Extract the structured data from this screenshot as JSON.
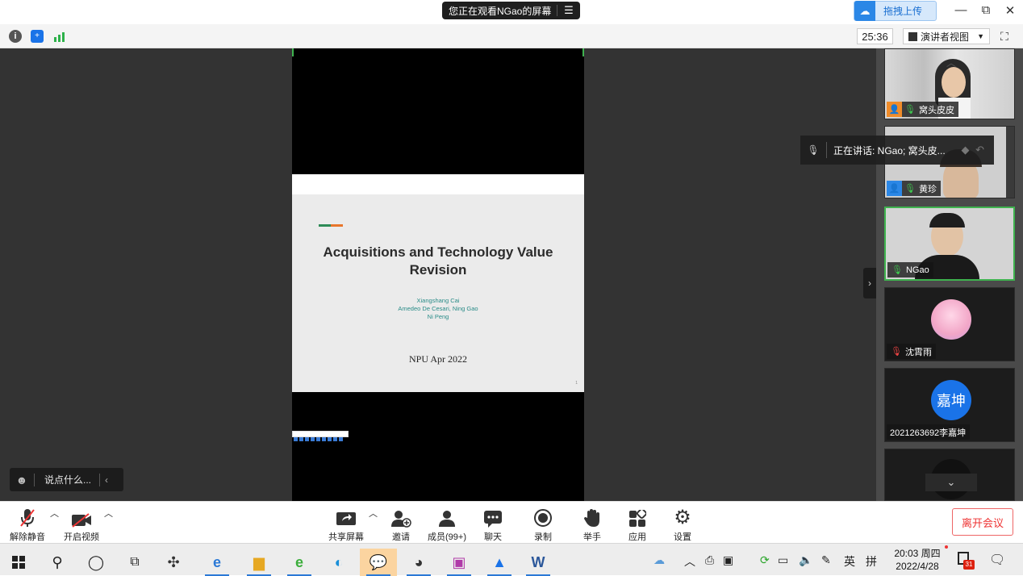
{
  "titlebar": {
    "share_status": "您正在观看NGao的屏幕",
    "menu_icon": "menu-lines-icon",
    "upload_button": "拖拽上传",
    "minimize": "—",
    "restore": "⧉",
    "close": "✕"
  },
  "toolbar": {
    "timer": "25:36",
    "view_mode": "演讲者视图"
  },
  "slide": {
    "title": "Acquisitions and Technology Value Revision",
    "authors_line1": "Xiangshang Cai",
    "authors_line2": "Amedeo De Cesari, Ning Gao",
    "authors_line3": "Ni Peng",
    "venue": "NPU Apr 2022",
    "page": "1"
  },
  "chat": {
    "placeholder": "说点什么..."
  },
  "speaking": {
    "text": "正在讲话: NGao; 窝头皮..."
  },
  "participants": [
    {
      "name": "窝头皮皮",
      "avatar_color": "#f08c2a"
    },
    {
      "name": "黄珍",
      "avatar_color": "#2b87e6"
    },
    {
      "name": "NGao",
      "avatar_color": ""
    },
    {
      "name": "沈霄雨",
      "avatar_color": ""
    },
    {
      "name": "2021263692李嘉坤",
      "avatar_text": "嘉坤",
      "avatar_color": "#1a73e8"
    },
    {
      "name": "",
      "avatar_color": ""
    }
  ],
  "controls": {
    "unmute": "解除静音",
    "start_video": "开启视频",
    "share_screen": "共享屏幕",
    "invite": "邀请",
    "members": "成员(99+)",
    "chat": "聊天",
    "record": "录制",
    "raise_hand": "举手",
    "apps": "应用",
    "settings": "设置",
    "leave": "离开会议"
  },
  "taskbar": {
    "time": "20:03 周四",
    "date": "2022/4/28",
    "ime": "英",
    "ime2": "拼",
    "notif_count": "31"
  }
}
